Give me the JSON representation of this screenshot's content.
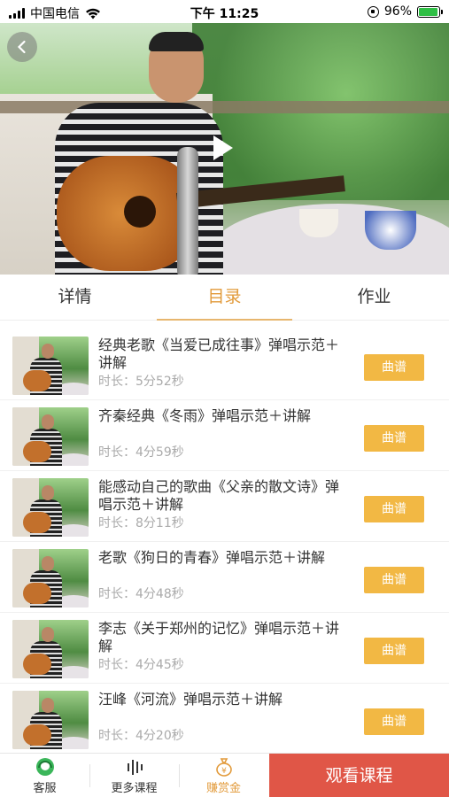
{
  "status_bar": {
    "carrier": "中国电信",
    "time": "下午 11:25",
    "battery": "96%",
    "battery_level": 0.96
  },
  "tabs": [
    {
      "label": "详情",
      "active": false
    },
    {
      "label": "目录",
      "active": true
    },
    {
      "label": "作业",
      "active": false
    }
  ],
  "lessons": [
    {
      "title": "经典老歌《当爱已成往事》弹唱示范＋讲解",
      "duration": "时长：5分52秒",
      "button": "曲谱"
    },
    {
      "title": "齐秦经典《冬雨》弹唱示范＋讲解",
      "duration": "时长：4分59秒",
      "button": "曲谱"
    },
    {
      "title": "能感动自己的歌曲《父亲的散文诗》弹唱示范＋讲解",
      "duration": "时长：8分11秒",
      "button": "曲谱"
    },
    {
      "title": "老歌《狗日的青春》弹唱示范＋讲解",
      "duration": "时长：4分48秒",
      "button": "曲谱"
    },
    {
      "title": "李志《关于郑州的记忆》弹唱示范＋讲解",
      "duration": "时长：4分45秒",
      "button": "曲谱"
    },
    {
      "title": "汪峰《河流》弹唱示范＋讲解",
      "duration": "时长：4分20秒",
      "button": "曲谱"
    }
  ],
  "bottom_bar": {
    "service": "客服",
    "more_courses": "更多课程",
    "reward": "赚赏金",
    "watch": "观看课程"
  },
  "colors": {
    "accent": "#e29a3a",
    "score_button": "#f2b844",
    "watch_button": "#e05647",
    "service_icon": "#3bb65a"
  },
  "icons": {
    "back": "chevron-left-icon",
    "play": "play-icon",
    "service": "headset-icon",
    "more_courses": "bars-icon",
    "reward": "money-bag-icon"
  }
}
